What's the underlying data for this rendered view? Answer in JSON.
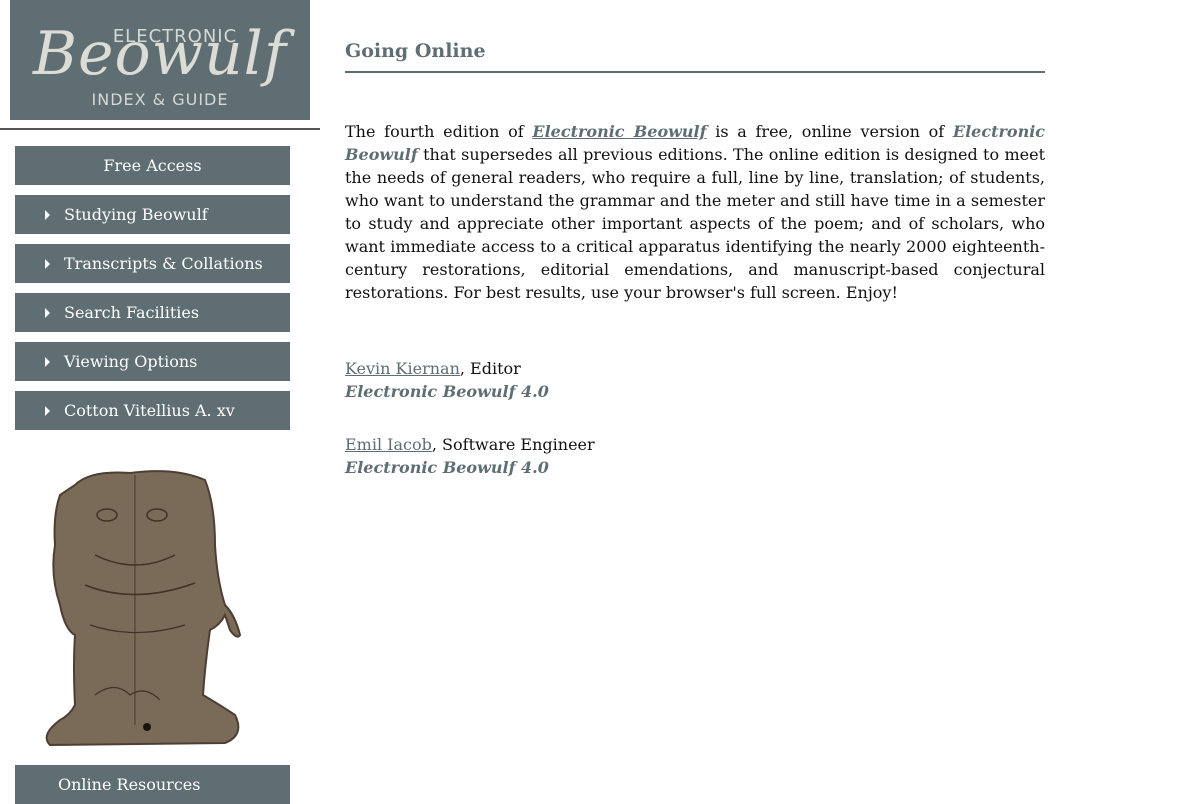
{
  "logo": {
    "top": "ELECTRONIC",
    "main": "Beowulf",
    "bottom": "INDEX & GUIDE"
  },
  "nav": {
    "free_access": "Free Access",
    "items": [
      {
        "label": "Studying Beowulf"
      },
      {
        "label": "Transcripts & Collations"
      },
      {
        "label": "Search Facilities"
      },
      {
        "label": "Viewing Options"
      },
      {
        "label": "Cotton Vitellius A. xv"
      }
    ],
    "online_resources": "Online Resources"
  },
  "main": {
    "title": "Going Online",
    "para": {
      "p1": "The fourth edition of ",
      "link_title": "Electronic Beowulf",
      "p2": " is a free, online version of ",
      "em_title": "Electronic Beowulf",
      "p3": " that supersedes all previous editions. The online edition is designed to meet the needs of general readers, who require a full, line by line, translation; of students, who want to understand the grammar and the meter and still have time in a semester to study and appreciate other important aspects of the poem; and of scholars, who want immediate access to a critical apparatus identifying the nearly 2000 eighteenth-century restorations, editorial emendations, and manuscript-based conjectural restorations. For best results, use your browser's full screen. Enjoy!"
    },
    "credits": [
      {
        "name": "Kevin Kiernan",
        "role": ", Editor",
        "edition": "Electronic Beowulf 4.0"
      },
      {
        "name": "Emil Iacob",
        "role": ", Software Engineer",
        "edition": "Electronic Beowulf 4.0"
      }
    ]
  },
  "colors": {
    "accent": "#5f6e72",
    "figure": "#7a6a58"
  }
}
